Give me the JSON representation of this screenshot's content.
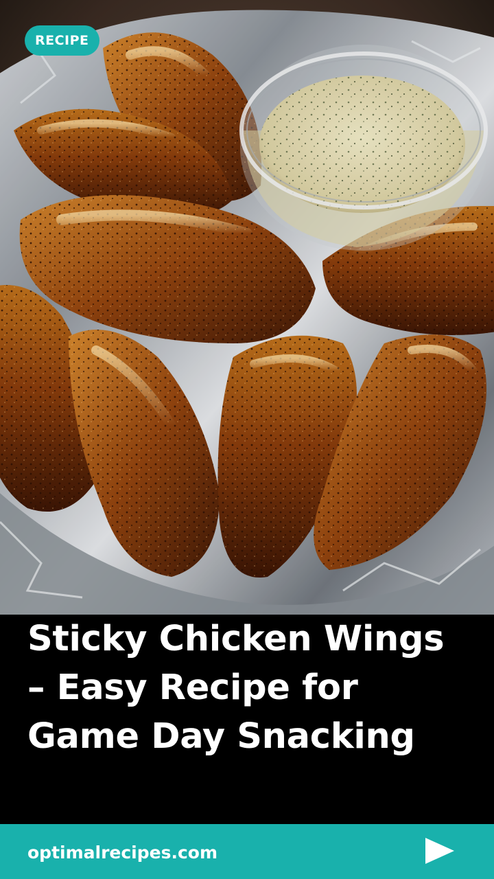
{
  "badge": {
    "label": "RECIPE"
  },
  "hero": {
    "image_icon": "chicken-wings-photo"
  },
  "article": {
    "title_lines": [
      "Sticky Chicken Wings",
      "– Easy Recipe for",
      "Game Day Snacking"
    ]
  },
  "footer": {
    "site": "optimalrecipes.com",
    "next_icon": "play-triangle-icon"
  },
  "colors": {
    "accent": "#19b1ac",
    "background": "#000000",
    "text": "#ffffff"
  }
}
